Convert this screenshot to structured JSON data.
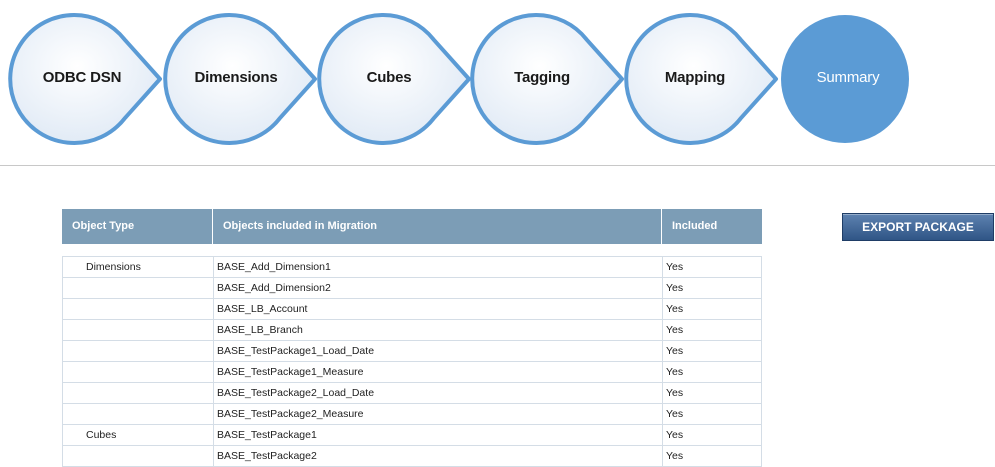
{
  "wizard": {
    "steps": [
      {
        "label": "ODBC DSN"
      },
      {
        "label": "Dimensions"
      },
      {
        "label": "Cubes"
      },
      {
        "label": "Tagging"
      },
      {
        "label": "Mapping"
      },
      {
        "label": "Summary"
      }
    ],
    "active_step": "Summary"
  },
  "export_button": "EXPORT PACKAGE",
  "table": {
    "columns": [
      "Object Type",
      "Objects included in Migration",
      "Included"
    ],
    "rows": [
      {
        "type": "Dimensions",
        "object": "BASE_Add_Dimension1",
        "included": "Yes"
      },
      {
        "type": "",
        "object": "BASE_Add_Dimension2",
        "included": "Yes"
      },
      {
        "type": "",
        "object": "BASE_LB_Account",
        "included": "Yes"
      },
      {
        "type": "",
        "object": "BASE_LB_Branch",
        "included": "Yes"
      },
      {
        "type": "",
        "object": "BASE_TestPackage1_Load_Date",
        "included": "Yes"
      },
      {
        "type": "",
        "object": "BASE_TestPackage1_Measure",
        "included": "Yes"
      },
      {
        "type": "",
        "object": "BASE_TestPackage2_Load_Date",
        "included": "Yes"
      },
      {
        "type": "",
        "object": "BASE_TestPackage2_Measure",
        "included": "Yes"
      },
      {
        "type": "Cubes",
        "object": "BASE_TestPackage1",
        "included": "Yes"
      },
      {
        "type": "",
        "object": "BASE_TestPackage2",
        "included": "Yes"
      }
    ]
  },
  "colors": {
    "step_fill": "#eaf1f9",
    "step_stroke": "#5b9bd5",
    "active_fill": "#5b9bd5",
    "header_bg": "#7c9db6"
  }
}
